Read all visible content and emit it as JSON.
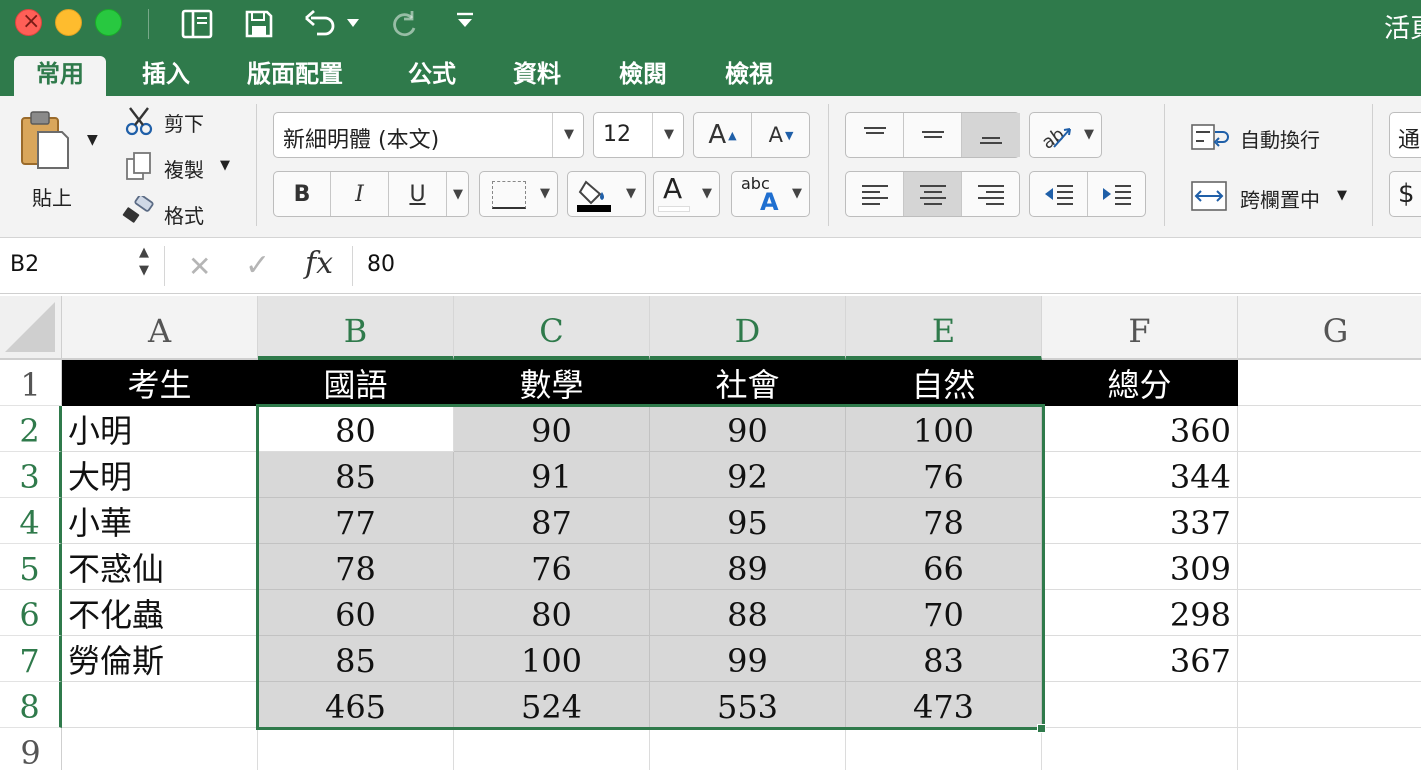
{
  "window": {
    "title": "活頁"
  },
  "toolbar_icons": [
    "sidebar-icon",
    "save-icon",
    "undo-icon",
    "redo-icon",
    "customize-icon"
  ],
  "tabs": [
    {
      "label": "常用",
      "active": true
    },
    {
      "label": "插入"
    },
    {
      "label": "版面配置"
    },
    {
      "label": "公式"
    },
    {
      "label": "資料"
    },
    {
      "label": "檢閱"
    },
    {
      "label": "檢視"
    }
  ],
  "ribbon": {
    "paste_label": "貼上",
    "cut_label": "剪下",
    "copy_label": "複製",
    "format_label": "格式",
    "font_name": "新細明體 (本文)",
    "font_size": "12",
    "bold": "B",
    "italic": "I",
    "underline": "U",
    "font_color_letter": "A",
    "abc_label": "abc",
    "wrap_text_label": "自動換行",
    "merge_center_label": "跨欄置中",
    "number_format_label": "通",
    "currency_label": "$"
  },
  "formula_bar": {
    "cell_ref": "B2",
    "fx": "fx",
    "value": "80"
  },
  "columns": [
    "A",
    "B",
    "C",
    "D",
    "E",
    "F",
    "G"
  ],
  "rows": [
    "1",
    "2",
    "3",
    "4",
    "5",
    "6",
    "7",
    "8",
    "9"
  ],
  "sheet": {
    "headers": [
      "考生",
      "國語",
      "數學",
      "社會",
      "自然",
      "總分"
    ],
    "data": [
      {
        "name": "小明",
        "scores": [
          "80",
          "90",
          "90",
          "100"
        ],
        "total": "360"
      },
      {
        "name": "大明",
        "scores": [
          "85",
          "91",
          "92",
          "76"
        ],
        "total": "344"
      },
      {
        "name": "小華",
        "scores": [
          "77",
          "87",
          "95",
          "78"
        ],
        "total": "337"
      },
      {
        "name": "不惑仙",
        "scores": [
          "78",
          "76",
          "89",
          "66"
        ],
        "total": "309"
      },
      {
        "name": "不化蟲",
        "scores": [
          "60",
          "80",
          "88",
          "70"
        ],
        "total": "298"
      },
      {
        "name": "勞倫斯",
        "scores": [
          "85",
          "100",
          "99",
          "83"
        ],
        "total": "367"
      }
    ],
    "column_totals": [
      "465",
      "524",
      "553",
      "473"
    ]
  },
  "colors": {
    "accent": "#2f7a4b",
    "header_bg": "#000000",
    "selection_bg": "#d8d8d8"
  }
}
